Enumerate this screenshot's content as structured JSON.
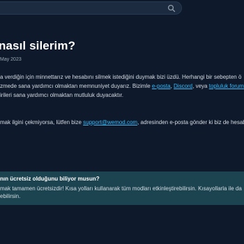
{
  "header": {
    "search_placeholder": "",
    "search_value": ""
  },
  "article": {
    "title": "nasıl silerim?",
    "date": "May 2023",
    "paragraph1": {
      "line1": "a verdiğin için minnettarız ve hesabını silmek istediğini duymak bizi üzdü. Herhangi bir sebepten ö",
      "line2_prefix": "zmede sana yardımcı olmaktan memnuniyet duyarız. Bizimle ",
      "link_email": "e-posta",
      "sep1": ", ",
      "link_discord": "Discord",
      "sep2": ", veya ",
      "link_forum": "topluluk forum",
      "line3": "irileri sana yardımcı olmaktan mutluluk duyacaktır."
    },
    "paragraph2": {
      "prefix": "mak ilgini çekmiyorsa, lütfen bize ",
      "email_link": "support@wemod.com",
      "suffix": ", adresinden e-posta gönder ki biz de hesab"
    }
  },
  "tip": {
    "title": "nın ücretsiz olduğunu biliyor musun?",
    "line1": "mak tamamen ücretsizdir! Kısa yolları kullanarak tüm modları etkinleştirebilirsin. Kısayollarla ile da",
    "line2": "ebilirsin."
  },
  "colors": {
    "background": "#0e1a2b",
    "link": "#38b7f5",
    "tip_background": "#1c4350"
  },
  "icons": {
    "search": "search-icon"
  }
}
